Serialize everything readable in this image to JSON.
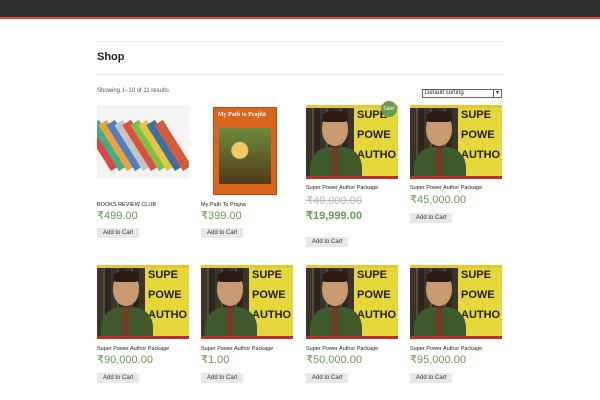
{
  "header": {
    "bar_color": "#303030",
    "accent_color": "#e5463d"
  },
  "page": {
    "title": "Shop",
    "result_count": "Showing 1–10 of 11 results",
    "sort": {
      "selected": "Default sorting"
    }
  },
  "products": [
    {
      "name": "BOOKS REVIEW CLUB",
      "price": "₹499.00",
      "button": "Add to Cart",
      "image": "books-stack"
    },
    {
      "name": "My Path To Prajna",
      "price": "₹399.00",
      "button": "Add to Cart",
      "image": "book-cover",
      "cover_title": "My Path to Prajñā"
    },
    {
      "name": "Super Power Author Package",
      "old_price": "₹40,000.00",
      "price": "₹19,999.00",
      "button": "Add to Cart",
      "badge": "Sale!",
      "image": "author"
    },
    {
      "name": "Super Power Author Package",
      "price": "₹45,000.00",
      "button": "Add to Cart",
      "image": "author"
    },
    {
      "name": "Super Power Author Package",
      "price": "₹90,000.00",
      "button": "Add to Cart",
      "image": "author"
    },
    {
      "name": "Super Power Author Package",
      "price": "₹1.00",
      "button": "Add to Cart",
      "image": "author"
    },
    {
      "name": "Super Power Author Package",
      "price": "₹50,000.00",
      "button": "Add to Cart",
      "image": "author"
    },
    {
      "name": "Super Power Author Package",
      "price": "₹95,000.00",
      "button": "Add to Cart",
      "image": "author"
    }
  ],
  "author_art": {
    "line1": "SUPE",
    "line2": "POWE",
    "line3": "AUTHO"
  },
  "colors": {
    "price": "#6a9a52",
    "sale_badge": "#6a9a52",
    "button_bg": "#e8e8e8"
  }
}
